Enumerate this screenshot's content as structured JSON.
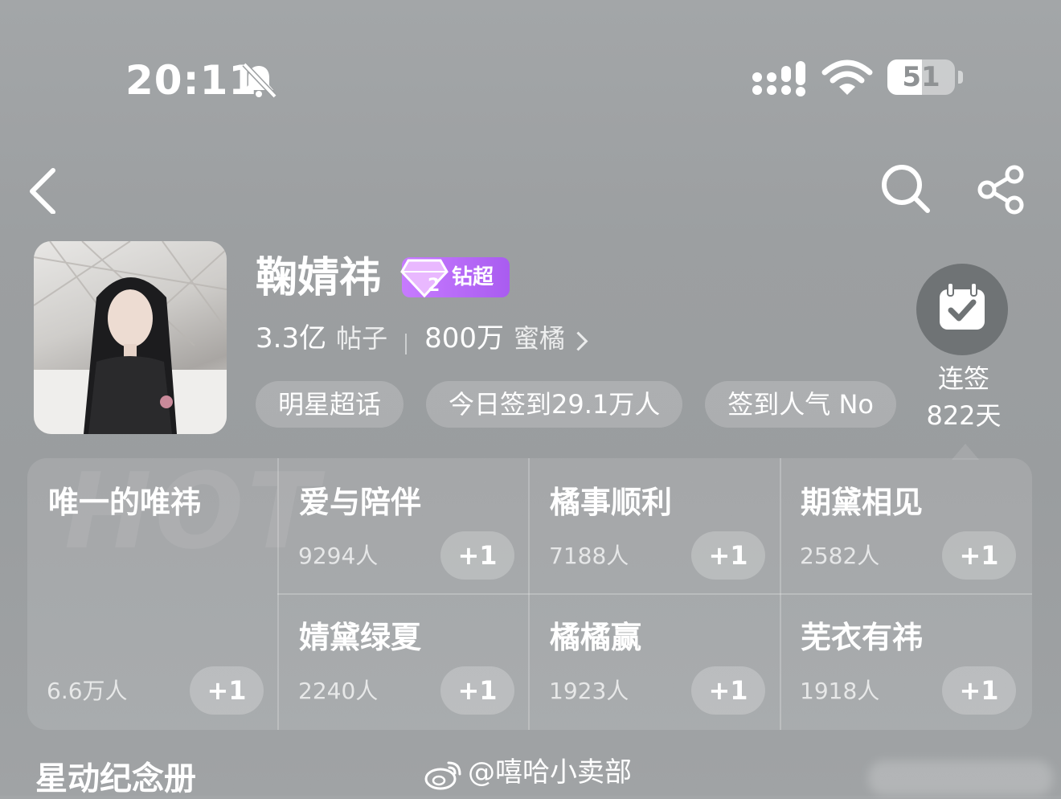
{
  "status_bar": {
    "time": "20:11",
    "battery": "51",
    "battery_level_percent": 51,
    "icons": [
      "bell-muted-icon",
      "signal-icon",
      "wifi-icon",
      "battery-icon"
    ]
  },
  "nav": {
    "icons": [
      "back-chevron-icon",
      "search-icon",
      "share-icon"
    ]
  },
  "topic": {
    "title": "鞠婧祎",
    "badge_label": "钻超",
    "badge_level": "2",
    "posts_value": "3.3亿",
    "posts_label": "帖子",
    "fans_value": "800万",
    "fans_label": "蜜橘",
    "chips": [
      "明星超话",
      "今日签到29.1万人",
      "签到人气 No"
    ]
  },
  "checkin": {
    "line1": "连签",
    "line2": "822天"
  },
  "hot_grid": {
    "watermark": "HOT",
    "plus_label": "+1",
    "items": [
      {
        "title": "唯一的唯祎",
        "count": "6.6万人"
      },
      {
        "title": "爱与陪伴",
        "count": "9294人"
      },
      {
        "title": "橘事顺利",
        "count": "7188人"
      },
      {
        "title": "期黛相见",
        "count": "2582人"
      },
      {
        "title": "婧黛绿夏",
        "count": "2240人"
      },
      {
        "title": "橘橘赢",
        "count": "1923人"
      },
      {
        "title": "芜衣有祎",
        "count": "1918人"
      }
    ]
  },
  "footer": {
    "section_title": "星动纪念册",
    "weibo_watermark": "@嘻哈小卖部"
  },
  "colors": {
    "background": "#9c9fa1",
    "badge_purple": "#b86bfb",
    "checkin_circle": "#6f7375"
  }
}
